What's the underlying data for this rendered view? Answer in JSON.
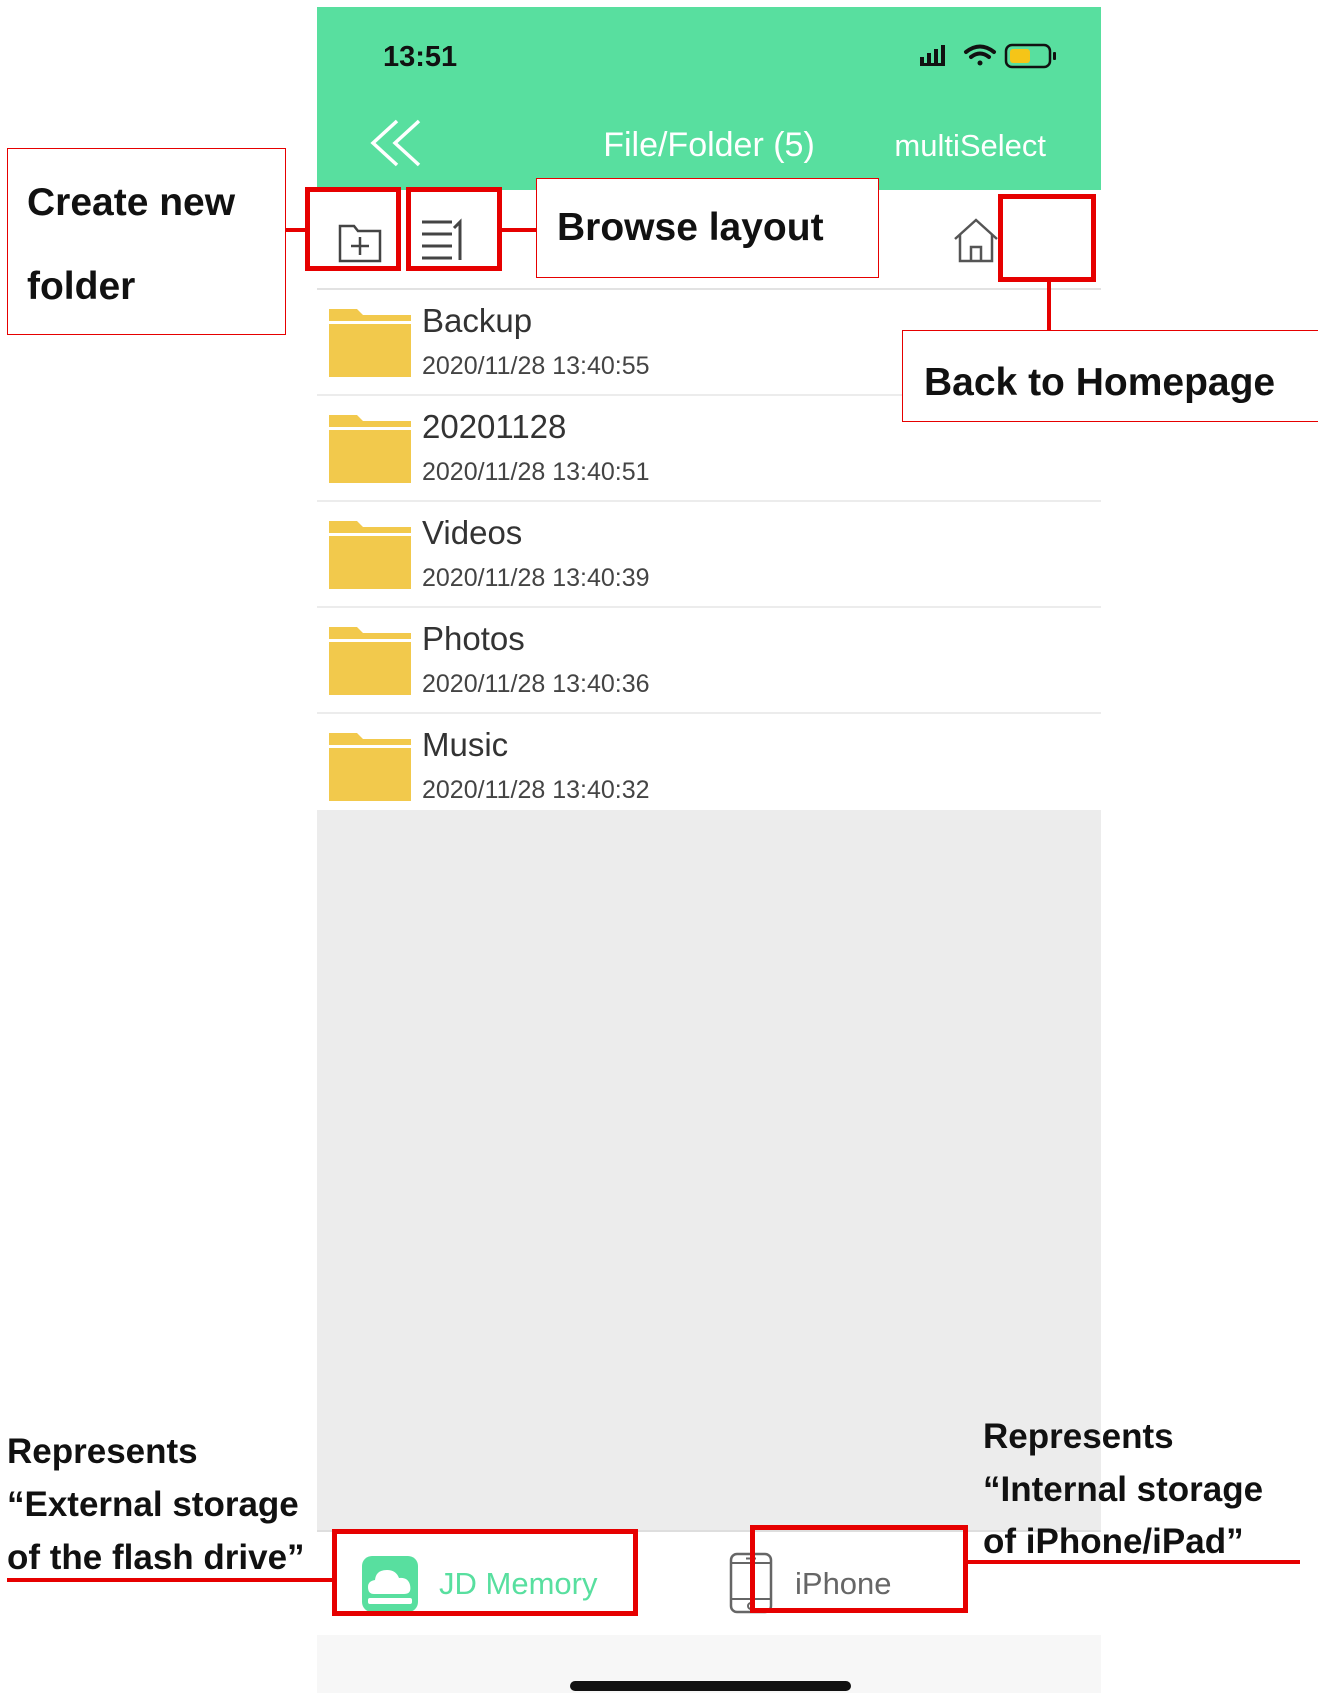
{
  "status_bar": {
    "time": "13:51"
  },
  "nav": {
    "title": "File/Folder (5)",
    "multi_select": "multiSelect"
  },
  "files": [
    {
      "name": "Backup",
      "date": "2020/11/28 13:40:55"
    },
    {
      "name": "20201128",
      "date": "2020/11/28 13:40:51"
    },
    {
      "name": "Videos",
      "date": "2020/11/28 13:40:39"
    },
    {
      "name": "Photos",
      "date": "2020/11/28 13:40:36"
    },
    {
      "name": "Music",
      "date": "2020/11/28 13:40:32"
    }
  ],
  "tabs": {
    "external": {
      "label": "JD Memory",
      "active": true
    },
    "internal": {
      "label": "iPhone",
      "active": false
    }
  },
  "annotations": {
    "create_folder_line1": "Create  new",
    "create_folder_line2": "folder",
    "browse_layout": "Browse layout",
    "back_home": "Back to Homepage",
    "external_line1": "Represents",
    "external_line2": "“External  storage",
    "external_line3": "of the flash drive”",
    "internal_line1": "Represents",
    "internal_line2": "“Internal storage",
    "internal_line3": "of iPhone/iPad”"
  },
  "colors": {
    "header_green": "#58df9f",
    "folder_yellow": "#f2c94c",
    "annotation_red": "#e60000",
    "active_tab_green": "#58df9f"
  }
}
